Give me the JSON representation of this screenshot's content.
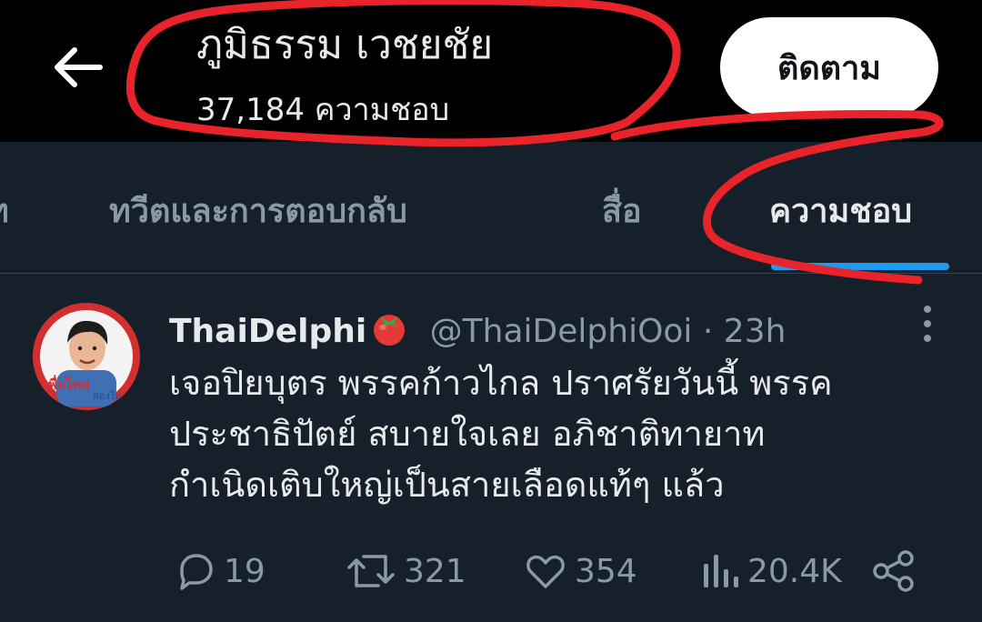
{
  "header": {
    "profile_name": "ภูมิธรรม เวชยชัย",
    "likes_count": "37,184 ความชอบ",
    "follow_label": "ติดตาม",
    "back_icon": "arrow-left-icon"
  },
  "tabs": [
    {
      "label": "ท"
    },
    {
      "label": "ทวีตและการตอบกลับ"
    },
    {
      "label": "สื่อ"
    },
    {
      "label": "ความชอบ",
      "active": true
    }
  ],
  "tweet": {
    "author_name": "ThaiDelphi",
    "author_emoji": "tomato-icon",
    "handle": "@ThaiDelphiOoi",
    "separator": "·",
    "time": "23h",
    "avatar_text": "เพื่อไทย",
    "avatar_subtext": "สองใบ",
    "text_lines": [
      "เจอปิยบุตร พรรคก้าวไกล ปราศรัยวันนี้ พรรค",
      "ประชาธิปัตย์ สบายใจเลย อภิชาติทายาท",
      "กำเนิดเติบใหญ่เป็นสายเลือดแท้ๆ แล้ว"
    ],
    "actions": {
      "replies": "19",
      "retweets": "321",
      "likes": "354",
      "views": "20.4K"
    }
  },
  "colors": {
    "background": "#15202b",
    "header_bg": "#000000",
    "accent": "#1d9bf0",
    "muted": "#8b98a5",
    "annotation": "#e8232a"
  }
}
